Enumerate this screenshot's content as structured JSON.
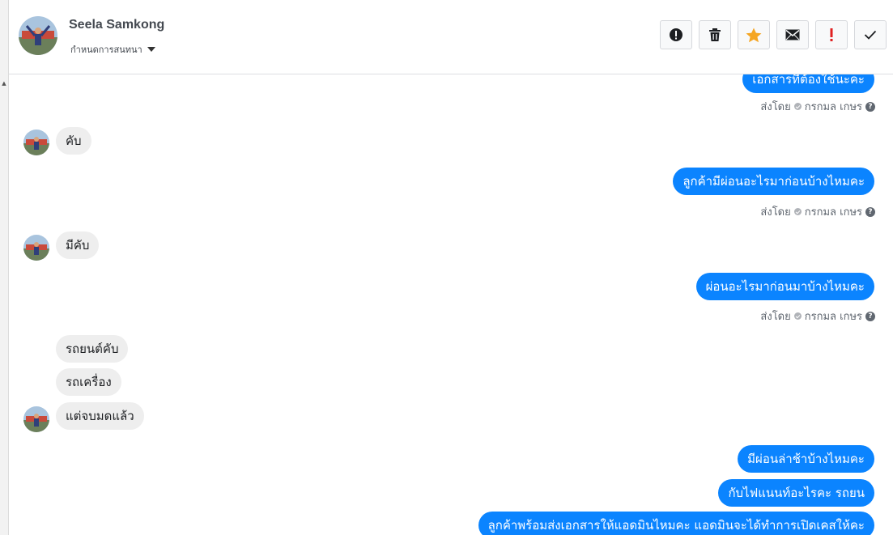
{
  "header": {
    "contact_name": "Seela Samkong",
    "subtitle": "กำหนดการสนทนา"
  },
  "toolbar": {
    "buttons": [
      {
        "name": "report-spam",
        "icon": "exclamation-circle-icon"
      },
      {
        "name": "delete",
        "icon": "trash-icon"
      },
      {
        "name": "star",
        "icon": "star-icon",
        "color": "#f5a623"
      },
      {
        "name": "mark-unread",
        "icon": "envelope-icon"
      },
      {
        "name": "important",
        "icon": "exclamation-icon",
        "color": "#e02020"
      },
      {
        "name": "done",
        "icon": "check-icon"
      }
    ]
  },
  "colors": {
    "outgoing_bubble": "#0b84ff",
    "incoming_bubble": "#eeeeee"
  },
  "messages": {
    "m0": {
      "text": "เอกสารที่ต้องใช้นะคะ"
    },
    "m0_meta": {
      "sent_by_label": "ส่งโดย",
      "agent": "กรกมล เกษร"
    },
    "m1": {
      "text": "คับ"
    },
    "m2": {
      "text": "ลูกค้ามีผ่อนอะไรมาก่อนบ้างไหมคะ"
    },
    "m2_meta": {
      "sent_by_label": "ส่งโดย",
      "agent": "กรกมล เกษร"
    },
    "m3": {
      "text": "มีคับ"
    },
    "m4": {
      "text": "ผ่อนอะไรมาก่อนมาบ้างไหมคะ"
    },
    "m4_meta": {
      "sent_by_label": "ส่งโดย",
      "agent": "กรกมล เกษร"
    },
    "m5": {
      "text": "รถยนต์คับ"
    },
    "m6": {
      "text": "รถเครื่อง"
    },
    "m7": {
      "text": "แต่จบมดแล้ว"
    },
    "m8": {
      "text": "มีผ่อนล่าช้าบ้างไหมคะ"
    },
    "m9": {
      "text": "กับไฟแนนท์อะไรคะ รถยน"
    },
    "m10": {
      "text": "ลูกค้าพร้อมส่งเอกสารให้แอดมินไหมคะ แอดมินจะได้ทำการเปิดเคสให้คะ"
    }
  }
}
